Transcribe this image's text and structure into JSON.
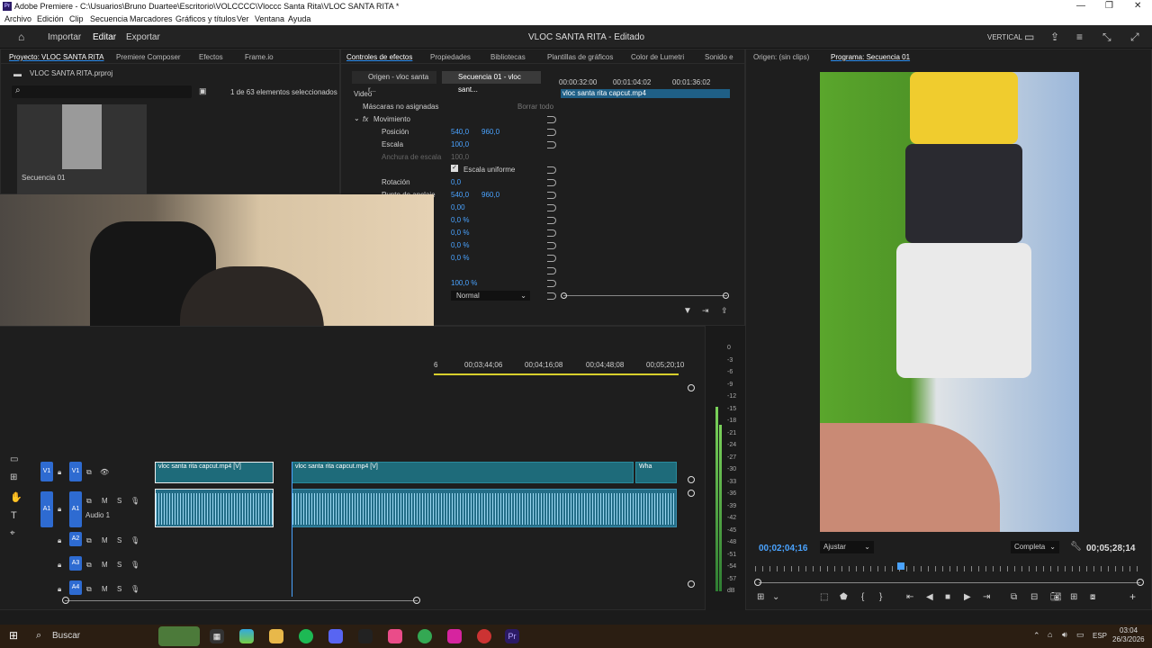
{
  "window": {
    "title": "Adobe Premiere - C:\\Usuarios\\Bruno Duartee\\Escritorio\\VOLCCCC\\Vloccc Santa Rita\\VLOC SANTA RITA *",
    "app_badge": "Pr"
  },
  "menu": [
    "Archivo",
    "Edición",
    "Clip",
    "Secuencia",
    "Marcadores",
    "Gráficos y títulos",
    "Ver",
    "Ventana",
    "Ayuda"
  ],
  "workspace": {
    "tabs": [
      "Importar",
      "Editar",
      "Exportar"
    ],
    "active_tab": "Editar",
    "project_title": "VLOC SANTA RITA - Editado",
    "layout_label": "VERTICAL"
  },
  "project_panel": {
    "tabs": [
      "Proyecto: VLOC SANTA RITA",
      "Premiere Composer",
      "Efectos",
      "Frame.io"
    ],
    "file": "VLOC SANTA RITA.prproj",
    "selection_count": "1 de 63 elementos seleccionados",
    "item_label": "Secuencia 01"
  },
  "effects_panel": {
    "tabs": [
      "Controles de efectos",
      "Propiedades",
      "Bibliotecas",
      "Plantillas de gráficos",
      "Color de Lumetri",
      "Sonido e"
    ],
    "source_tab": "Origen - vloc santa r...",
    "sequence_tab": "Secuencia 01 - vloc sant...",
    "timecodes": [
      "00:00:32:00",
      "00:01:04:02",
      "00:01:36:02"
    ],
    "section": "Video",
    "clip_label": "vloc santa rita capcut.mp4",
    "masks_label": "Máscaras no asignadas",
    "clear_all": "Borrar todo",
    "fx_group": "Movimiento",
    "rows": [
      {
        "name": "Posición",
        "v1": "540,0",
        "v2": "960,0"
      },
      {
        "name": "Escala",
        "v1": "100,0",
        "v2": ""
      },
      {
        "name": "Anchura de escala",
        "v1": "100,0",
        "v2": ""
      },
      {
        "name": "Escala uniforme",
        "v1": "",
        "v2": ""
      },
      {
        "name": "Rotación",
        "v1": "0,0",
        "v2": ""
      },
      {
        "name": "Punto de anclaje",
        "v1": "540,0",
        "v2": "960,0"
      },
      {
        "name": "",
        "v1": "0,00",
        "v2": ""
      },
      {
        "name": "",
        "v1": "0,0 %",
        "v2": ""
      },
      {
        "name": "",
        "v1": "0,0 %",
        "v2": ""
      },
      {
        "name": "",
        "v1": "0,0 %",
        "v2": ""
      },
      {
        "name": "",
        "v1": "0,0 %",
        "v2": ""
      },
      {
        "name": "",
        "v1": "100,0 %",
        "v2": ""
      }
    ],
    "blend_mode": "Normal"
  },
  "timeline": {
    "ruler": [
      "6",
      "00;03;44;06",
      "00;04;16;08",
      "00;04;48;08",
      "00;05;20;10"
    ],
    "tracks": [
      {
        "id": "V1",
        "label": "V1",
        "type": "video"
      },
      {
        "id": "A1",
        "label": "A1",
        "name": "Audio 1",
        "type": "audio"
      },
      {
        "id": "A2",
        "label": "A2",
        "type": "audio"
      },
      {
        "id": "A3",
        "label": "A3",
        "type": "audio"
      },
      {
        "id": "A4",
        "label": "A4",
        "type": "audio"
      }
    ],
    "clips": [
      "vloc santa rita capcut.mp4 [V]",
      "vloc santa rita capcut.mp4 [V]",
      "Wha"
    ]
  },
  "meter_ticks": [
    "0",
    "-3",
    "-6",
    "-9",
    "-12",
    "-15",
    "-18",
    "-21",
    "-24",
    "-27",
    "-30",
    "-33",
    "-36",
    "-39",
    "-42",
    "-45",
    "-48",
    "-51",
    "-54",
    "-57",
    "dB"
  ],
  "program": {
    "source_tab": "Origen: (sin clips)",
    "program_tab": "Programa: Secuencia 01",
    "timecode": "00;02;04;16",
    "zoom": "Ajustar",
    "quality": "Completa",
    "duration": "00;05;28;14"
  },
  "taskbar": {
    "search": "Buscar",
    "lang": "ESP",
    "time": "03:04",
    "date": "26/3/2026"
  }
}
